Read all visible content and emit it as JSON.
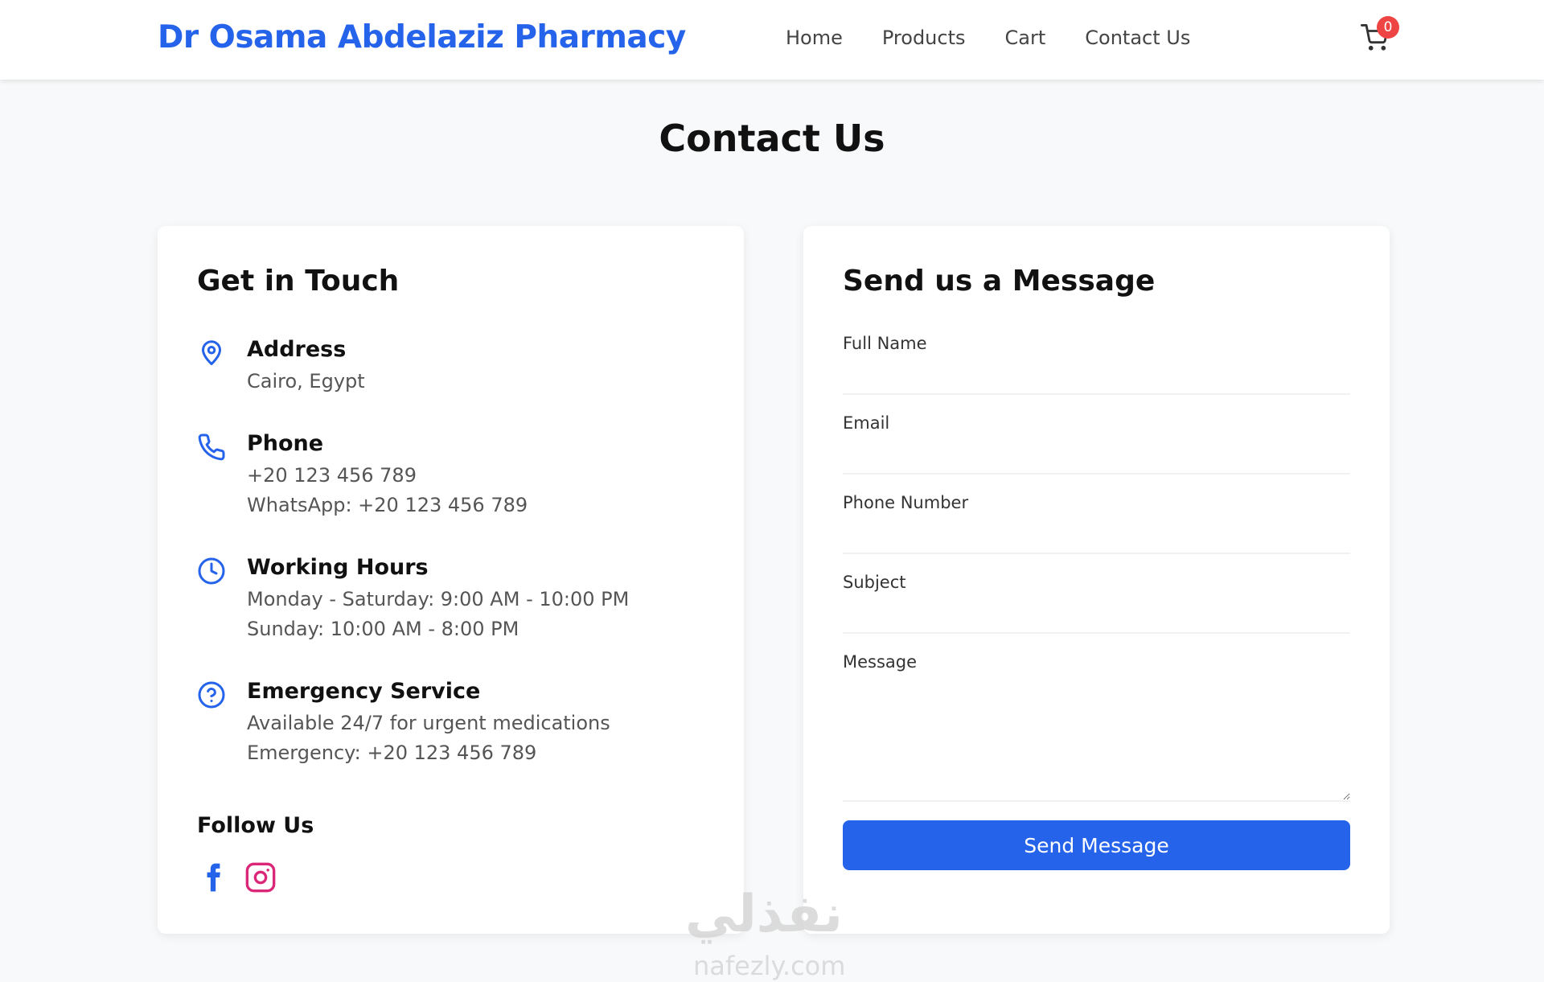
{
  "header": {
    "brand": "Dr Osama Abdelaziz Pharmacy",
    "nav": [
      "Home",
      "Products",
      "Cart",
      "Contact Us"
    ],
    "cart_icon": "cart-icon",
    "cart_count": "0",
    "brand_color": "#2563eb",
    "badge_color": "#ef4444"
  },
  "page": {
    "title": "Contact Us"
  },
  "contact_info": {
    "title": "Get in Touch",
    "items": [
      {
        "icon": "map-pin-icon",
        "title": "Address",
        "lines": [
          "Cairo, Egypt"
        ]
      },
      {
        "icon": "phone-icon",
        "title": "Phone",
        "lines": [
          "+20 123 456 789",
          "WhatsApp: +20 123 456 789"
        ]
      },
      {
        "icon": "clock-icon",
        "title": "Working Hours",
        "lines": [
          "Monday - Saturday: 9:00 AM - 10:00 PM",
          "Sunday: 10:00 AM - 8:00 PM"
        ]
      },
      {
        "icon": "help-circle-icon",
        "title": "Emergency Service",
        "lines": [
          "Available 24/7 for urgent medications",
          "Emergency: +20 123 456 789"
        ]
      }
    ],
    "follow": {
      "title": "Follow Us",
      "icons": [
        "facebook-icon",
        "instagram-icon"
      ],
      "facebook_color": "#2563eb",
      "instagram_color": "#db2777"
    }
  },
  "form": {
    "title": "Send us a Message",
    "fields": [
      {
        "label": "Full Name",
        "value": ""
      },
      {
        "label": "Email",
        "value": ""
      },
      {
        "label": "Phone Number",
        "value": ""
      },
      {
        "label": "Subject",
        "value": ""
      },
      {
        "label": "Message",
        "value": ""
      }
    ],
    "submit_label": "Send Message"
  },
  "watermark": {
    "arabic": "نفذلي",
    "latin": "nafezly.com"
  }
}
